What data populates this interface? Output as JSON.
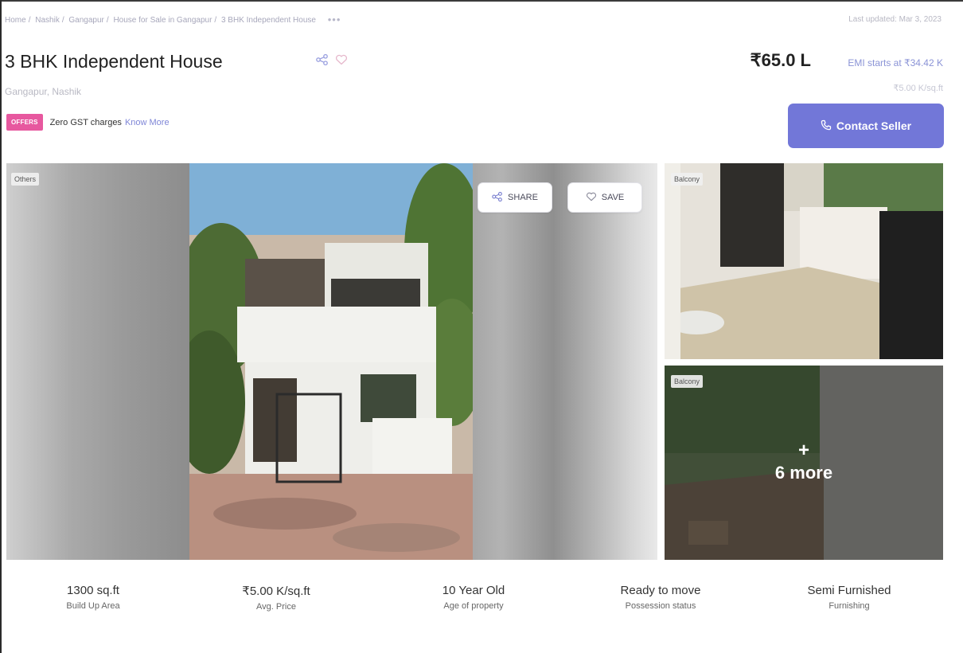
{
  "breadcrumb": {
    "items": [
      "Home",
      "Nashik",
      "Gangapur",
      "House for Sale in Gangapur",
      "3 BHK Independent House"
    ],
    "more": "•••"
  },
  "last_updated": "Last updated: Mar 3, 2023",
  "listing": {
    "title": "3 BHK Independent House",
    "location": "Gangapur, Nashik",
    "price": "₹65.0 L",
    "emi": "EMI starts at ₹34.42 K",
    "price_per_sqft": "₹5.00 K/sq.ft"
  },
  "offers": {
    "badge": "OFFERS",
    "text": "Zero GST charges",
    "link": "Know More"
  },
  "contact_button": "Contact Seller",
  "gallery": {
    "main_tag": "Others",
    "share_label": "SHARE",
    "save_label": "SAVE",
    "thumb1_tag": "Balcony",
    "thumb2_tag": "Balcony",
    "more_plus": "+",
    "more_label": "6 more"
  },
  "stats": [
    {
      "value": "1300 sq.ft",
      "label": "Build Up Area"
    },
    {
      "value": "₹5.00 K/sq.ft",
      "label": "Avg. Price"
    },
    {
      "value": "10 Year Old",
      "label": "Age of property"
    },
    {
      "value": "Ready to move",
      "label": "Possession status"
    },
    {
      "value": "Semi Furnished",
      "label": "Furnishing"
    }
  ],
  "colors": {
    "accent": "#7277d8",
    "offer_badge": "#e7589f",
    "link": "#7f86d7"
  },
  "icons": {
    "share": "share-icon",
    "heart": "heart-icon",
    "phone": "phone-icon"
  }
}
